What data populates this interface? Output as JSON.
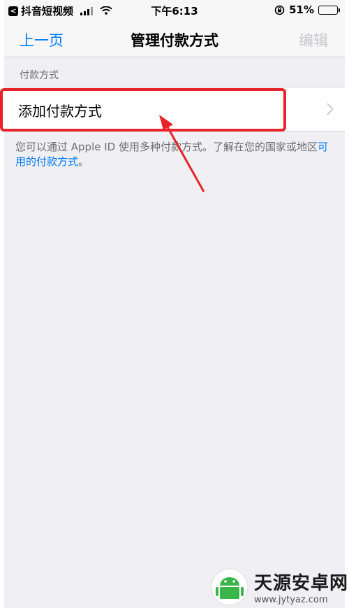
{
  "status_bar": {
    "back_app_glyph": "<",
    "app_name": "抖音短视频",
    "time": "下午6:13",
    "battery_percent_label": "51%",
    "battery_level": 0.51
  },
  "nav": {
    "back_label": "上一页",
    "title": "管理付款方式",
    "edit_label": "编辑"
  },
  "section": {
    "header": "付款方式",
    "cell_label": "添加付款方式"
  },
  "footer": {
    "text_before": "您可以通过 Apple ID 使用多种付款方式。了解在您的国家或地区",
    "link": "可用的付款方式",
    "text_after": "。"
  },
  "watermark": {
    "main": "天源安卓网",
    "sub": "www.jytyaz.com"
  },
  "colors": {
    "accent": "#007aff",
    "annotation": "#e8232a",
    "background": "#efeff4"
  }
}
